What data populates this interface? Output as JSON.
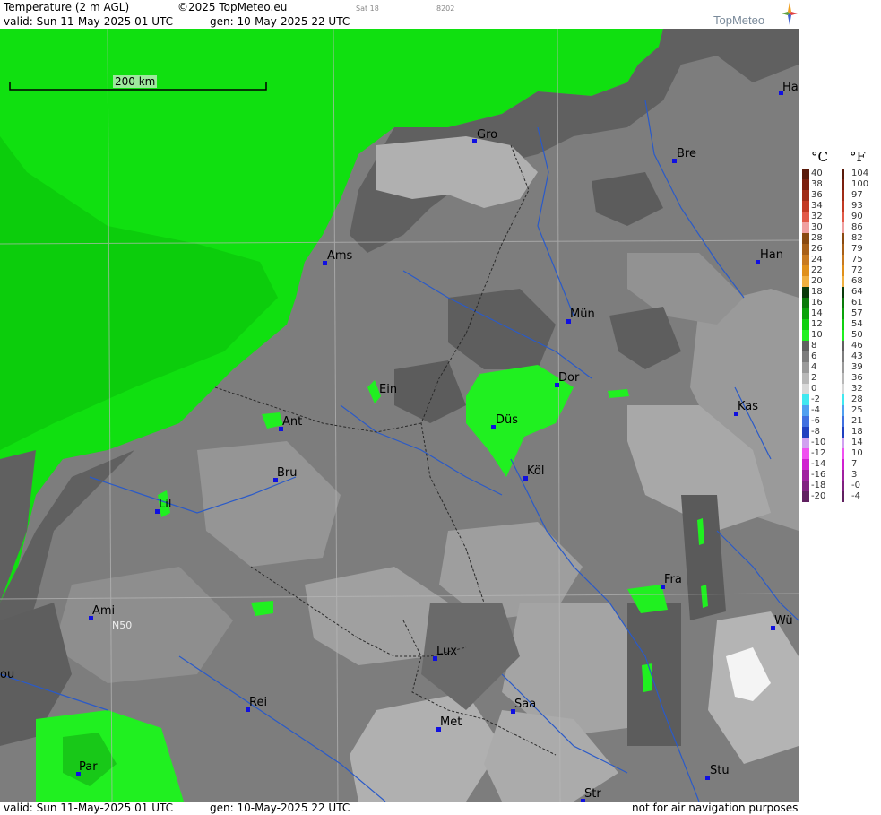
{
  "header": {
    "title": "Temperature (2 m AGL)",
    "copyright": "©2025 TopMeteo.eu",
    "day_tag": "Sat 18",
    "code": "8202",
    "valid": "valid:  Sun  11-May-2025  01 UTC",
    "generated": "gen: 10-May-2025 22 UTC",
    "logo": "TopMeteo"
  },
  "footer": {
    "valid": "valid:  Sun  11-May-2025  01 UTC",
    "generated": "gen: 10-May-2025 22 UTC",
    "disclaimer": "not for air navigation purposes"
  },
  "map": {
    "scale_label": "200 km",
    "latitude_label": "N50",
    "cities": [
      {
        "id": "ha1",
        "label": "Ha"
      },
      {
        "id": "gro",
        "label": "Gro"
      },
      {
        "id": "bre",
        "label": "Bre"
      },
      {
        "id": "ams",
        "label": "Ams"
      },
      {
        "id": "han",
        "label": "Han"
      },
      {
        "id": "mun",
        "label": "Mün"
      },
      {
        "id": "ein",
        "label": "Ein"
      },
      {
        "id": "dor",
        "label": "Dor"
      },
      {
        "id": "dus",
        "label": "Düs"
      },
      {
        "id": "ant",
        "label": "Ant"
      },
      {
        "id": "kas",
        "label": "Kas"
      },
      {
        "id": "kol",
        "label": "Köl"
      },
      {
        "id": "bru",
        "label": "Bru"
      },
      {
        "id": "lil",
        "label": "Lil"
      },
      {
        "id": "fra",
        "label": "Fra"
      },
      {
        "id": "ami",
        "label": "Ami"
      },
      {
        "id": "wur",
        "label": "Wü"
      },
      {
        "id": "lux",
        "label": "Lux"
      },
      {
        "id": "bou",
        "label": "ou"
      },
      {
        "id": "rei",
        "label": "Rei"
      },
      {
        "id": "saa",
        "label": "Saa"
      },
      {
        "id": "met",
        "label": "Met"
      },
      {
        "id": "par",
        "label": "Par"
      },
      {
        "id": "stu",
        "label": "Stu"
      },
      {
        "id": "str",
        "label": "Str"
      }
    ]
  },
  "legend": {
    "unit_c": "°C",
    "unit_f": "°F",
    "celsius": [
      "40",
      "38",
      "36",
      "34",
      "32",
      "30",
      "28",
      "26",
      "24",
      "22",
      "20",
      "18",
      "16",
      "14",
      "12",
      "10",
      "8",
      "6",
      "4",
      "2",
      "0",
      "-2",
      "-4",
      "-6",
      "-8",
      "-10",
      "-12",
      "-14",
      "-16",
      "-18",
      "-20"
    ],
    "fahrenheit": [
      "104",
      "100",
      "97",
      "93",
      "90",
      "86",
      "82",
      "79",
      "75",
      "72",
      "68",
      "64",
      "61",
      "57",
      "54",
      "50",
      "46",
      "43",
      "39",
      "36",
      "32",
      "28",
      "25",
      "21",
      "18",
      "14",
      "10",
      "7",
      "3",
      "-0",
      "-4"
    ],
    "colors": [
      "#5a1a0a",
      "#7a1f0e",
      "#a02c16",
      "#c23a22",
      "#e25a48",
      "#f0a0a0",
      "#8a4a10",
      "#a86018",
      "#c87a20",
      "#e0901a",
      "#f0b040",
      "#0a3a0a",
      "#0a7a0a",
      "#0aa20a",
      "#10d010",
      "#20f020",
      "#606060",
      "#7d7d7d",
      "#9a9a9a",
      "#b8b8b8",
      "#d8d8d8",
      "#40e8f0",
      "#50a0f0",
      "#4070e0",
      "#2040c0",
      "#d0a0f0",
      "#f050f0",
      "#d020d0",
      "#a020a0",
      "#802080",
      "#602060"
    ]
  }
}
